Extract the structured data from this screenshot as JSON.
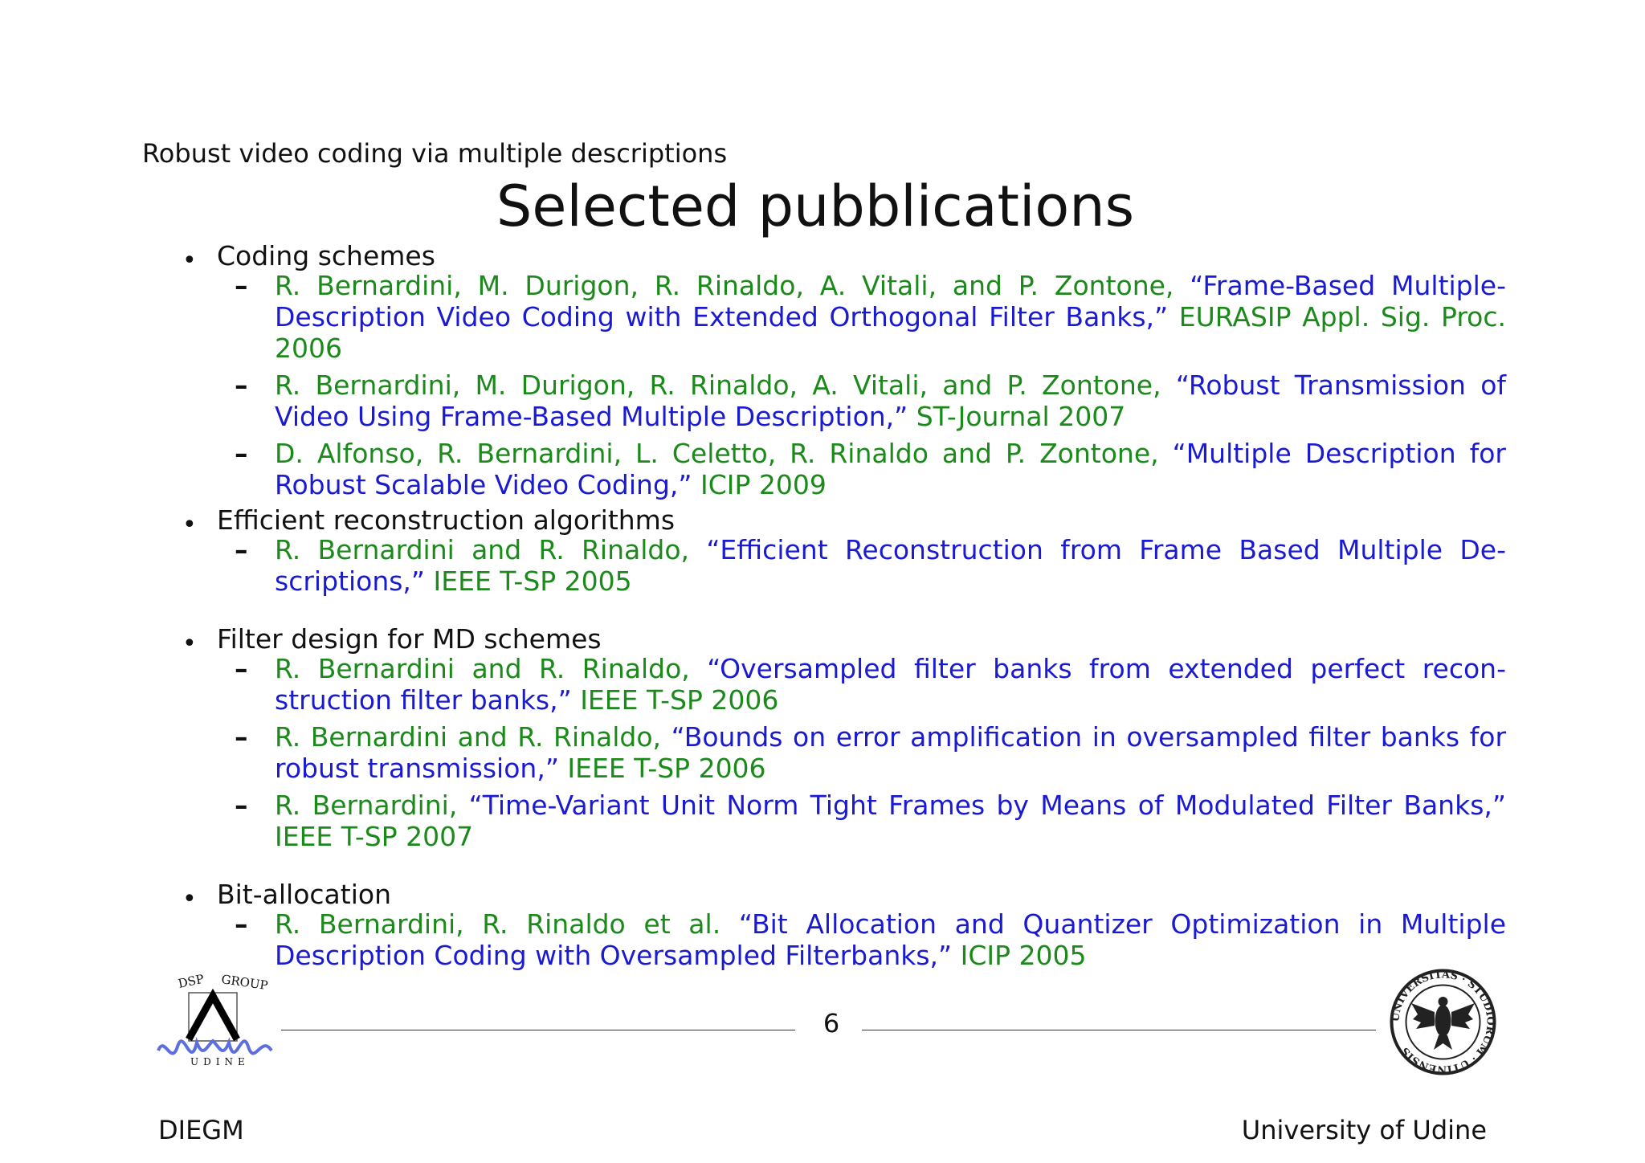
{
  "header": {
    "subtitle": "Robust video coding via multiple descriptions",
    "title": "Selected pubblications"
  },
  "sections": [
    {
      "heading": "Coding schemes",
      "entries": [
        {
          "authors": "R. Bernardini, M. Durigon, R. Rinaldo, A. Vitali, and P. Zontone,",
          "title": "“Frame-Based Multiple-Description Video Coding with Extended Orthogonal Filter Banks,”",
          "venue": "EURASIP Appl. Sig. Proc. 2006"
        },
        {
          "authors": "R. Bernardini, M. Durigon, R. Rinaldo, A. Vitali, and P. Zontone,",
          "title": "“Robust Transmission of Video Using Frame-Based Multiple Description,”",
          "venue": "ST-Journal 2007"
        },
        {
          "authors": "D. Alfonso, R. Bernardini, L. Celetto, R. Rinaldo and P. Zontone,",
          "title": "“Multiple Description for Robust Scalable Video Coding,”",
          "venue": "ICIP 2009"
        }
      ]
    },
    {
      "heading": "Efficient reconstruction algorithms",
      "entries": [
        {
          "authors": "R. Bernardini and R. Rinaldo,",
          "title": "“Efficient Reconstruction from Frame Based Multiple De-scriptions,”",
          "venue": "IEEE T-SP 2005"
        }
      ]
    },
    {
      "heading": "Filter design for MD schemes",
      "entries": [
        {
          "authors": "R. Bernardini and R. Rinaldo,",
          "title": "“Oversampled filter banks from extended perfect recon-struction filter banks,”",
          "venue": "IEEE T-SP 2006"
        },
        {
          "authors": "R. Bernardini and R. Rinaldo,",
          "title": "“Bounds on error amplification in oversampled filter banks for robust transmission,”",
          "venue": "IEEE T-SP 2006"
        },
        {
          "authors": "R. Bernardini,",
          "title": "“Time-Variant Unit Norm Tight Frames by Means of Modulated Filter Banks,”",
          "venue": "IEEE T-SP 2007"
        }
      ]
    },
    {
      "heading": "Bit-allocation",
      "entries": [
        {
          "authors": "R. Bernardini, R. Rinaldo et al.",
          "title": "“Bit Allocation and Quantizer Optimization in Multiple Description Coding with Oversampled Filterbanks,”",
          "venue": "ICIP 2005"
        }
      ]
    }
  ],
  "footer": {
    "page_number": "6",
    "left": "DIEGM",
    "right": "University of Udine"
  },
  "logos": {
    "dsp_group": "DSP GROUP",
    "dsp_udine": "U D I N E",
    "seal_text": "UNIVERSITAS · STUDIORUM · UTINENSIS"
  },
  "colors": {
    "authors": "#1b8a1b",
    "title": "#1a1ad0",
    "venue": "#1b8a1b"
  }
}
